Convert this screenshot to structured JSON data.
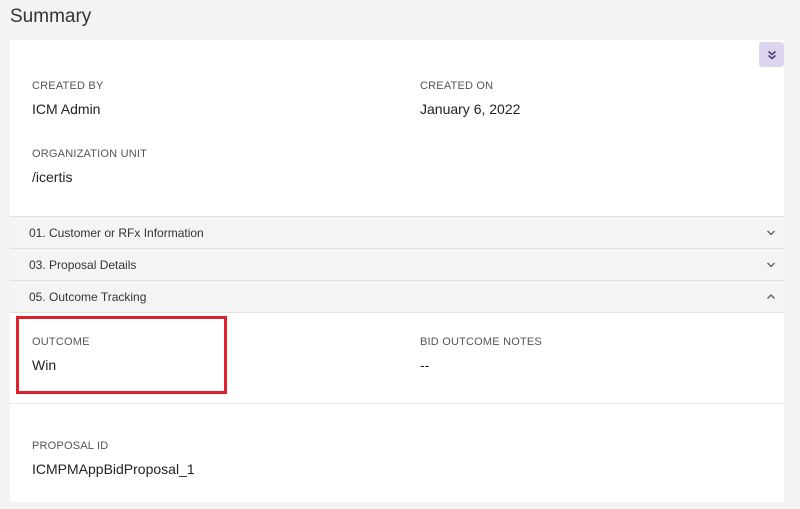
{
  "page": {
    "title": "Summary"
  },
  "summary": {
    "created_by": {
      "label": "CREATED BY",
      "value": "ICM Admin"
    },
    "created_on": {
      "label": "CREATED ON",
      "value": "January 6, 2022"
    },
    "org_unit": {
      "label": "ORGANIZATION UNIT",
      "value": "/icertis"
    }
  },
  "sections": [
    {
      "label": "01. Customer or RFx Information",
      "expanded": false
    },
    {
      "label": "03. Proposal Details",
      "expanded": false
    },
    {
      "label": "05. Outcome Tracking",
      "expanded": true
    }
  ],
  "outcome_tracking": {
    "outcome": {
      "label": "OUTCOME",
      "value": "Win"
    },
    "bid_outcome_notes": {
      "label": "BID OUTCOME NOTES",
      "value": "--"
    },
    "proposal_id": {
      "label": "PROPOSAL ID",
      "value": "ICMPMAppBidProposal_1"
    }
  },
  "colors": {
    "highlight": "#e0202a",
    "collapse_button_bg": "#ddd4f0"
  },
  "icons": {
    "collapse_all": "double-chevron-down-icon",
    "section_collapsed": "chevron-down-icon",
    "section_expanded": "chevron-up-icon"
  }
}
